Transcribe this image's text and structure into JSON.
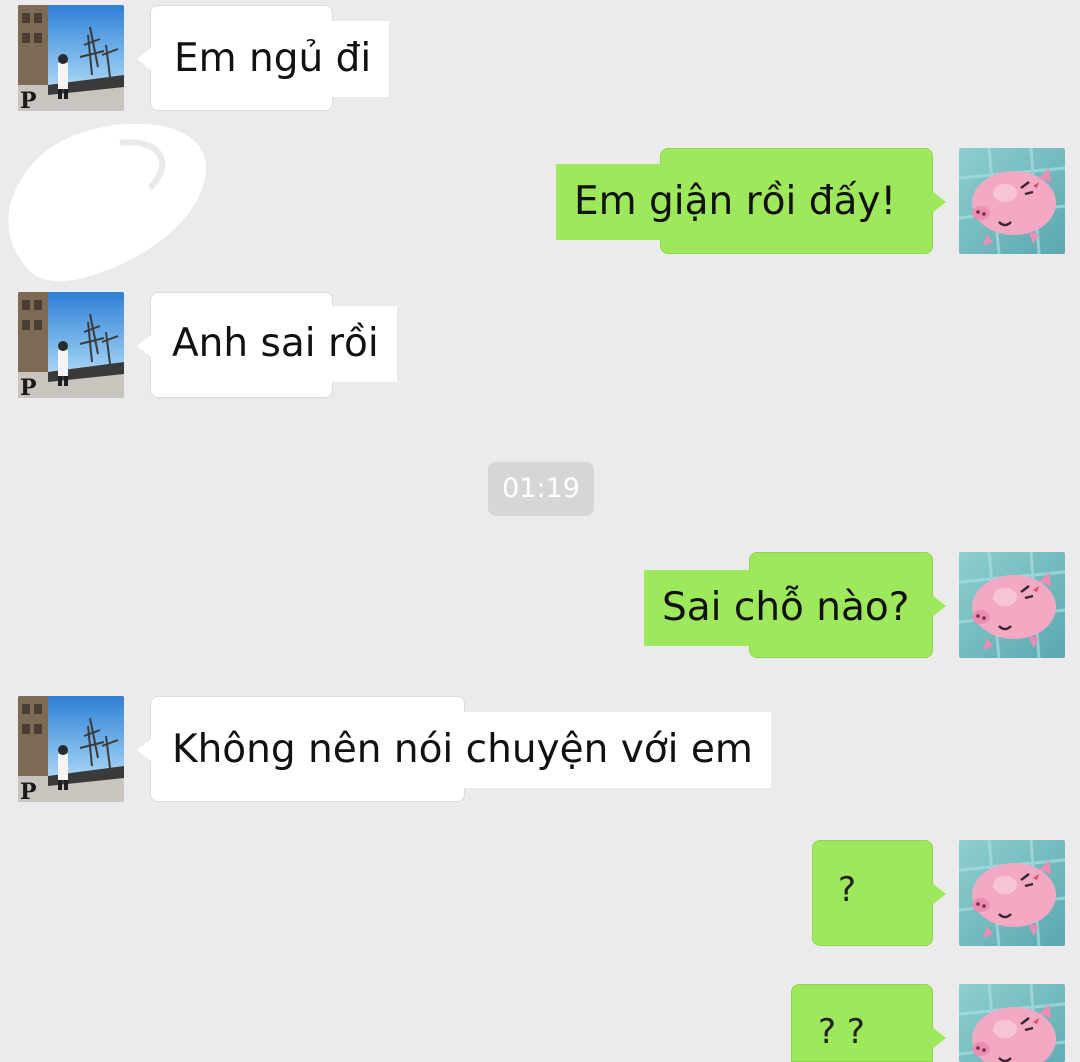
{
  "conversation": {
    "messages": [
      {
        "direction": "incoming",
        "text": "Em ngủ đi"
      },
      {
        "direction": "outgoing",
        "text": "Em giận rồi đấy!"
      },
      {
        "direction": "incoming",
        "text": "Anh sai rồi"
      },
      {
        "direction": "outgoing",
        "text": "Sai chỗ nào?"
      },
      {
        "direction": "incoming",
        "text": "Không nên nói chuyện với em"
      },
      {
        "direction": "outgoing",
        "text": "?"
      },
      {
        "direction": "outgoing",
        "text": "? ?"
      }
    ],
    "timestamp": "01:19"
  },
  "avatars": {
    "contact": "contact-avatar-street-photo",
    "self": "self-avatar-pink-pig-sticker"
  },
  "colors": {
    "background": "#ebebeb",
    "incoming_bubble": "#ffffff",
    "outgoing_bubble": "#9ee85c",
    "timestamp_bg": "#d6d6d6"
  }
}
